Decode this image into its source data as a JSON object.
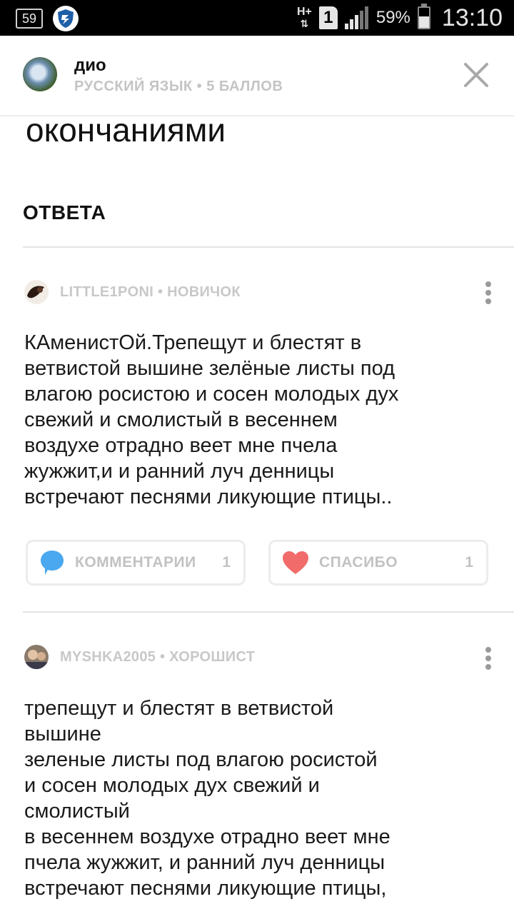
{
  "status_bar": {
    "notification_count": "59",
    "network_type": "H+",
    "sim_slot": "1",
    "battery_percent": "59%",
    "time": "13:10"
  },
  "header": {
    "user_name": "дио",
    "subtitle": "РУССКИЙ ЯЗЫК • 5 БАЛЛОВ",
    "close_icon": "close-icon"
  },
  "question": {
    "text_tail": "окончаниями"
  },
  "answers_section": {
    "heading": "ОТВЕТА"
  },
  "answers": [
    {
      "author": "LITTLE1PONI • НОВИЧОК",
      "lines": [
        "КАменистОй.Трепещут и блестят в",
        "ветвистой вышине зелёные листы под",
        "влагою росистою и сосен молодых дух",
        "свежий и смолистый в весеннем",
        "воздухе отрадно веет мне пчела",
        "жужжит,и и ранний луч денницы",
        "встречают песнями ликующие птицы.."
      ],
      "comments_label": "КОММЕНТАРИИ",
      "comments_count": "1",
      "thanks_label": "СПАСИБО",
      "thanks_count": "1"
    },
    {
      "author": "MYSHKA2005 • ХОРОШИСТ",
      "lines": [
        "трепещут и блестят в ветвистой",
        "вышине",
        "зеленые листы под влагою росистой",
        "и сосен молодых дух свежий и",
        "смолистый",
        "в весеннем воздухе отрадно веет мне",
        "пчела жужжит, и ранний луч денницы",
        "встречают песнями ликующие птицы,"
      ]
    }
  ],
  "colors": {
    "comment_icon": "#4aa8f0",
    "heart_icon": "#f26b6b",
    "muted_text": "#c4c4c4"
  }
}
